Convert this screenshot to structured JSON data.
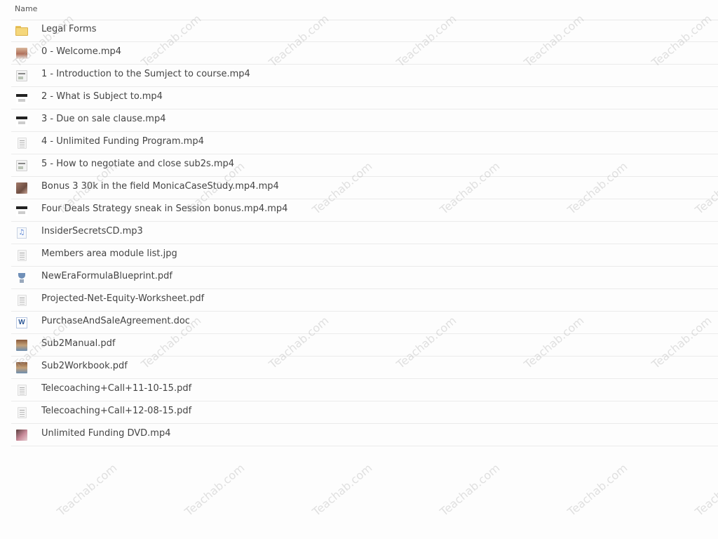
{
  "header": {
    "name_column": "Name"
  },
  "files": [
    {
      "name": "Legal Forms",
      "icon": "folder-icon"
    },
    {
      "name": "0 - Welcome.mp4",
      "icon": "video-thumbnail-icon"
    },
    {
      "name": "1 - Introduction to the Sumject to course.mp4",
      "icon": "video-thumbnail-icon"
    },
    {
      "name": "2 - What is Subject to.mp4",
      "icon": "video-thumbnail-icon"
    },
    {
      "name": "3 - Due on sale clause.mp4",
      "icon": "video-thumbnail-icon"
    },
    {
      "name": "4 - Unlimited Funding Program.mp4",
      "icon": "video-thumbnail-icon"
    },
    {
      "name": "5 - How to negotiate and close sub2s.mp4",
      "icon": "video-thumbnail-icon"
    },
    {
      "name": "Bonus 3 30k in the field MonicaCaseStudy.mp4.mp4",
      "icon": "video-thumbnail-icon"
    },
    {
      "name": "Four Deals Strategy sneak in Session bonus.mp4.mp4",
      "icon": "video-thumbnail-icon"
    },
    {
      "name": "InsiderSecretsCD.mp3",
      "icon": "audio-file-icon"
    },
    {
      "name": "Members area module list.jpg",
      "icon": "image-thumbnail-icon"
    },
    {
      "name": "NewEraFormulaBlueprint.pdf",
      "icon": "pdf-thumbnail-icon"
    },
    {
      "name": "Projected-Net-Equity-Worksheet.pdf",
      "icon": "pdf-thumbnail-icon"
    },
    {
      "name": "PurchaseAndSaleAgreement.doc",
      "icon": "word-document-icon"
    },
    {
      "name": "Sub2Manual.pdf",
      "icon": "pdf-thumbnail-icon"
    },
    {
      "name": "Sub2Workbook.pdf",
      "icon": "pdf-thumbnail-icon"
    },
    {
      "name": "Telecoaching+Call+11-10-15.pdf",
      "icon": "pdf-thumbnail-icon"
    },
    {
      "name": "Telecoaching+Call+12-08-15.pdf",
      "icon": "pdf-thumbnail-icon"
    },
    {
      "name": "Unlimited Funding DVD.mp4",
      "icon": "video-thumbnail-icon"
    }
  ],
  "watermark": {
    "text": "Teachab.com"
  }
}
